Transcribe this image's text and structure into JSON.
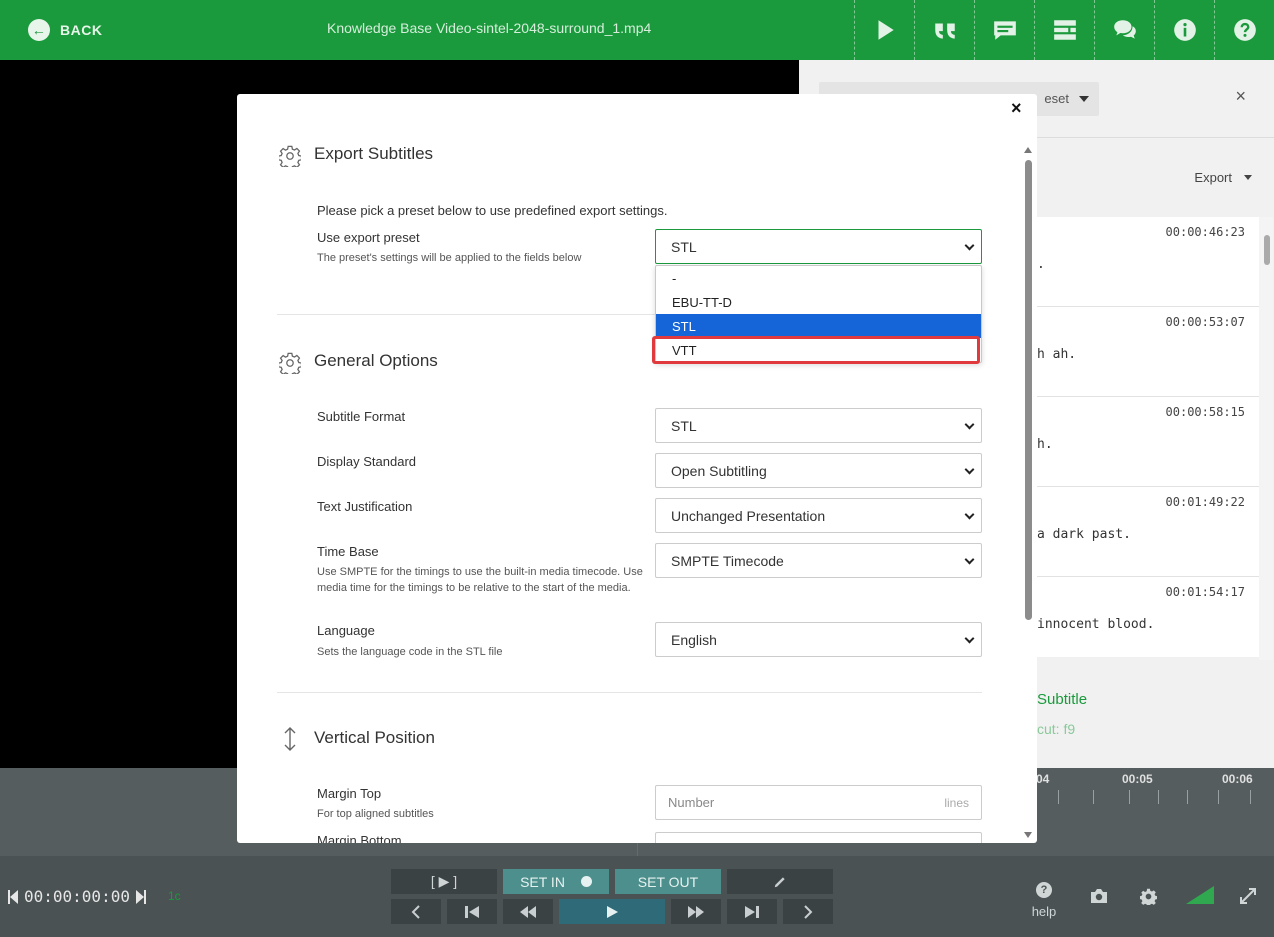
{
  "header": {
    "back_label": "BACK",
    "back_arrow": "←",
    "title": "Knowledge Base Video-sintel-2048-surround_1.mp4"
  },
  "toolbar_icons": [
    "play-icon",
    "quote-icon",
    "subtitle-icon",
    "layout-icon",
    "comments-icon",
    "info-icon",
    "help-icon"
  ],
  "right_panel": {
    "preset_partial": "eset",
    "close_glyph": "×",
    "export_label": "Export",
    "rows": [
      {
        "time": "00:00:46:23",
        "text": "."
      },
      {
        "time": "00:00:53:07",
        "text": "h ah."
      },
      {
        "time": "00:00:58:15",
        "text": "h."
      },
      {
        "time": "00:01:49:22",
        "text": "a dark past."
      },
      {
        "time": "00:01:54:17",
        "text": "innocent blood."
      }
    ],
    "add_label": "Subtitle",
    "shortcut_label": "cut: f9"
  },
  "timeline": {
    "labels": [
      "04",
      "00:05",
      "00:06"
    ]
  },
  "controls": {
    "timecode": "00:00:00:00",
    "fps": "1c",
    "play_in_out": "[ ▶ ]",
    "set_in": "SET IN",
    "set_out": "SET OUT",
    "help_label": "help",
    "help_glyph": "?"
  },
  "modal": {
    "close_glyph": "×",
    "export_section": {
      "title": "Export Subtitles",
      "intro": "Please pick a preset below to use predefined export settings.",
      "preset_label": "Use export preset",
      "preset_help": "The preset's settings will be applied to the fields below",
      "preset_value": "STL",
      "preset_options": [
        "-",
        "EBU-TT-D",
        "STL",
        "VTT"
      ],
      "selected_option": "STL"
    },
    "general_section": {
      "title": "General Options",
      "subtitle_format_label": "Subtitle Format",
      "subtitle_format_value": "STL",
      "display_standard_label": "Display Standard",
      "display_standard_value": "Open Subtitling",
      "text_justification_label": "Text Justification",
      "text_justification_value": "Unchanged Presentation",
      "time_base_label": "Time Base",
      "time_base_help": "Use SMPTE for the timings to use the built-in media timecode. Use media time for the timings to be relative to the start of the media.",
      "time_base_value": "SMPTE Timecode",
      "language_label": "Language",
      "language_help": "Sets the language code in the STL file",
      "language_value": "English"
    },
    "vertical_section": {
      "title": "Vertical Position",
      "margin_top_label": "Margin Top",
      "margin_top_help": "For top aligned subtitles",
      "margin_top_placeholder": "Number",
      "margin_top_suffix": "lines",
      "margin_bottom_label": "Margin Bottom"
    }
  },
  "colors": {
    "brand_green": "#1a9a3c",
    "selected_blue": "#1565d8",
    "highlight_red": "#e0393e"
  }
}
